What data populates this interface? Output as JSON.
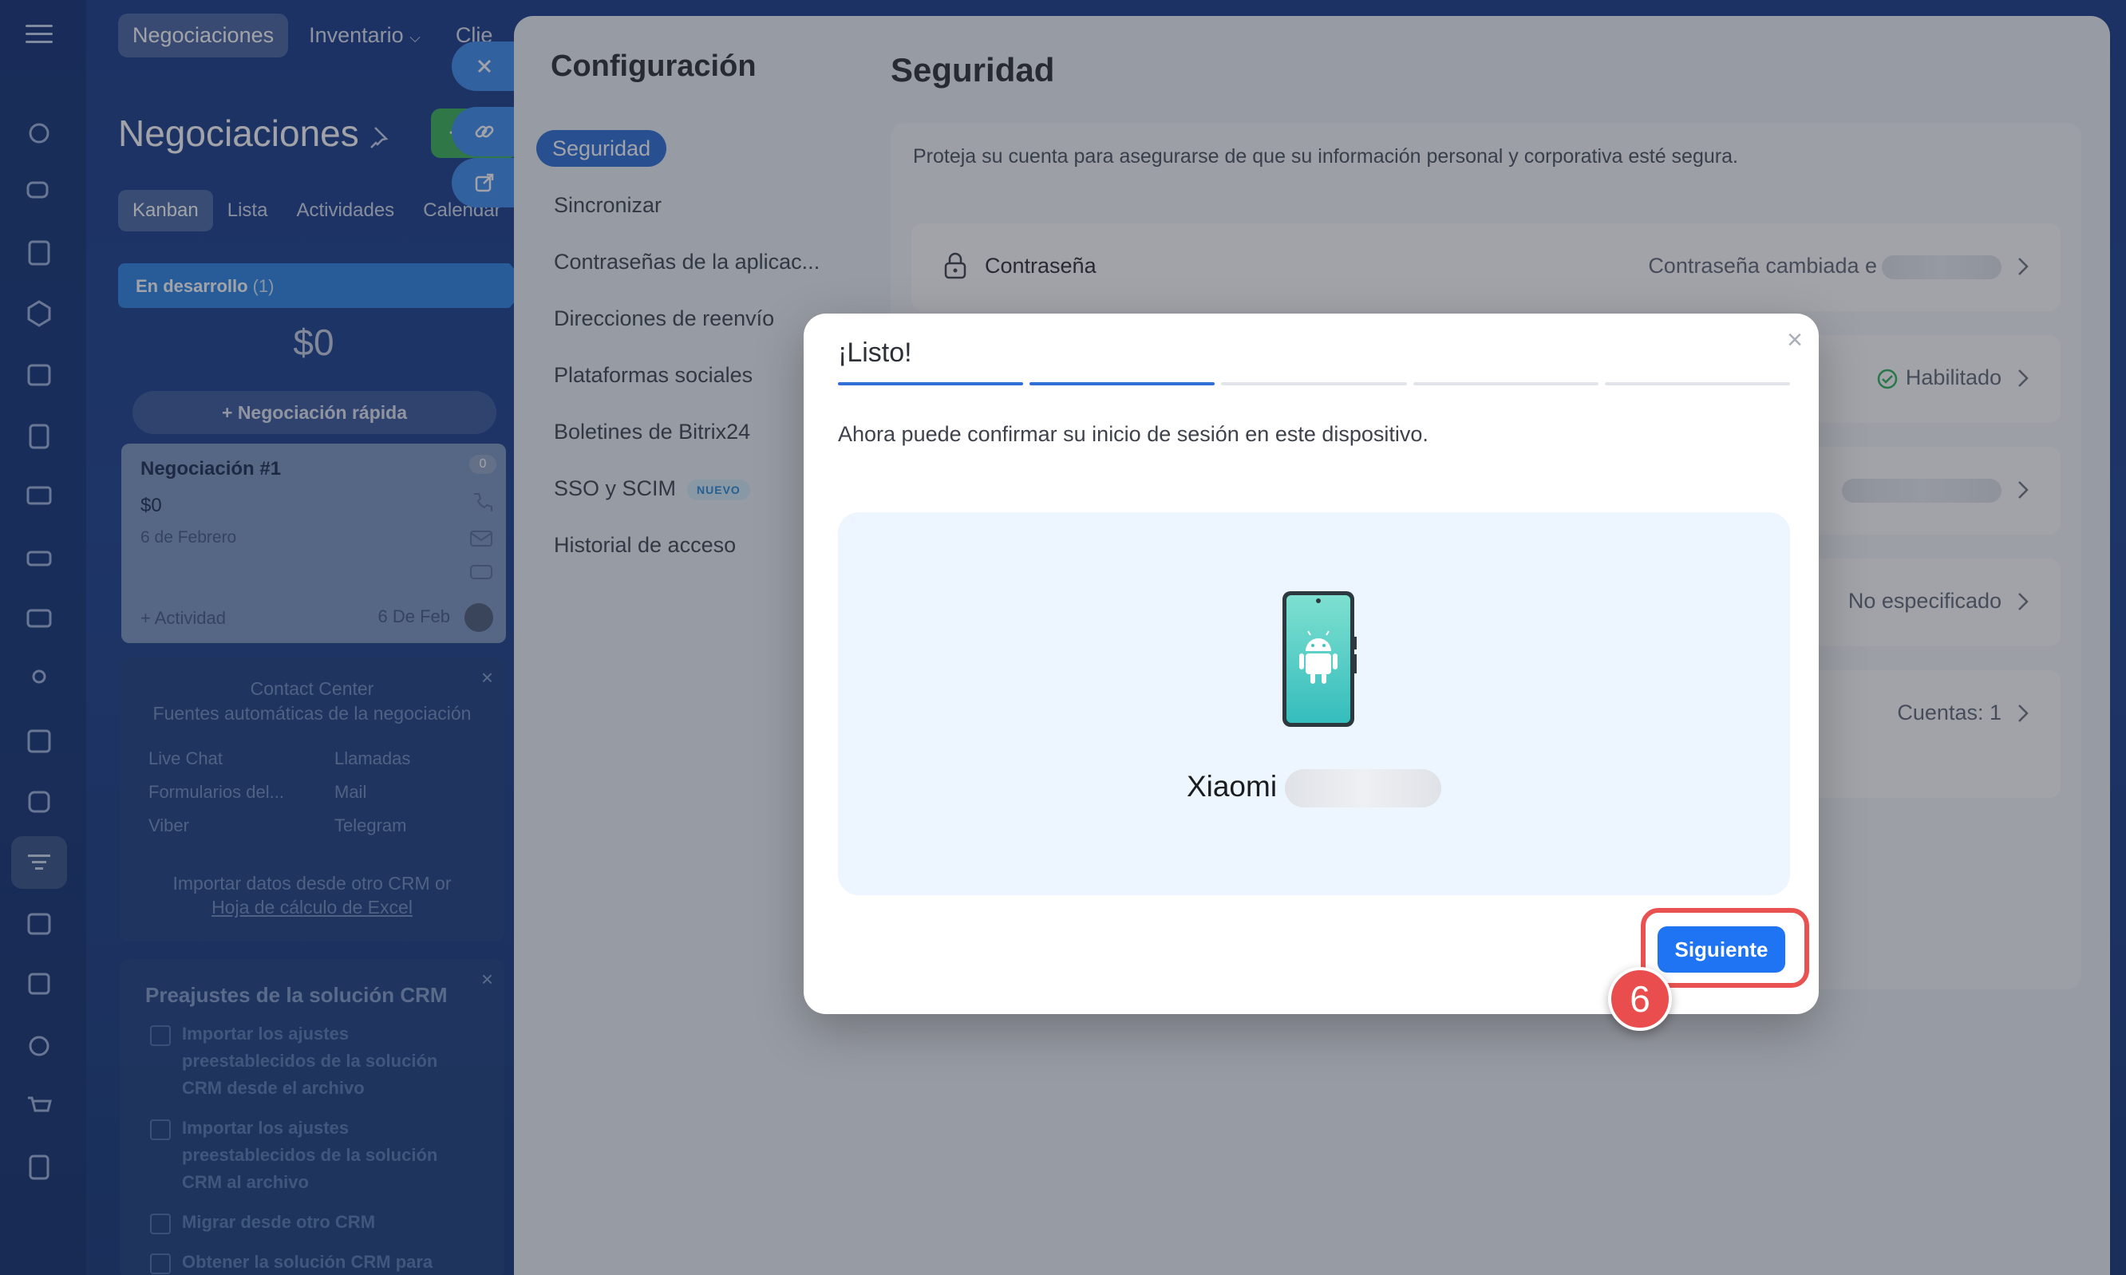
{
  "topnav": [
    "Negociaciones",
    "Inventario",
    "Clie"
  ],
  "crm": {
    "title": "Negociaciones",
    "add_label": "+",
    "view_tabs": [
      "Kanban",
      "Lista",
      "Actividades",
      "Calendar"
    ],
    "column": {
      "name": "En desarrollo",
      "count": "(1)",
      "sum": "$0",
      "quick_deal": "+ Negociación rápida"
    },
    "deal": {
      "title": "Negociación #1",
      "sum": "$0",
      "date": "6 de Febrero",
      "activity": "+ Actividad",
      "due": "6 De Feb",
      "badge": "0"
    },
    "contact_center": {
      "title": "Contact Center",
      "subtitle": "Fuentes automáticas de la negociación",
      "channels": [
        "Live Chat",
        "Llamadas",
        "Formularios del...",
        "Mail",
        "Viber",
        "Telegram"
      ],
      "import_line1": "Importar datos desde otro CRM or",
      "import_line2": "Hoja de cálculo de Excel"
    },
    "presets": {
      "title": "Preajustes de la solución CRM",
      "items": [
        "Importar los ajustes preestablecidos de la solución CRM desde el archivo",
        "Importar los ajustes preestablecidos de la solución CRM al archivo",
        "Migrar desde otro CRM",
        "Obtener la solución CRM para"
      ]
    }
  },
  "settings": {
    "title": "Configuración",
    "menu": [
      {
        "label": "Seguridad"
      },
      {
        "label": "Sincronizar"
      },
      {
        "label": "Contraseñas de la aplicac..."
      },
      {
        "label": "Direcciones de reenvío"
      },
      {
        "label": "Plataformas sociales"
      },
      {
        "label": "Boletines de Bitrix24"
      },
      {
        "label": "SSO y SCIM",
        "badge": "NUEVO"
      },
      {
        "label": "Historial de acceso"
      }
    ]
  },
  "security": {
    "title": "Seguridad",
    "description": "Proteja su cuenta para asegurarse de que su información personal y corporativa esté segura.",
    "rows": [
      {
        "label": "Contraseña",
        "value": "Contraseña cambiada e"
      },
      {
        "label": "",
        "value": "Habilitado"
      },
      {
        "label": "",
        "value": ""
      },
      {
        "label": "",
        "value": "No especificado"
      },
      {
        "label": "",
        "value": "Cuentas: 1"
      }
    ]
  },
  "modal": {
    "title": "¡Listo!",
    "steps_total": 5,
    "steps_done": 2,
    "message": "Ahora puede confirmar su inicio de sesión en este dispositivo.",
    "device_name": "Xiaomi",
    "next_label": "Siguiente",
    "close_label": "×"
  },
  "step_marker": "6",
  "colors": {
    "accent": "#1e74f2",
    "highlight": "#ea5252",
    "android": "#ffffff",
    "phone_screen": "#3ec7c0"
  }
}
